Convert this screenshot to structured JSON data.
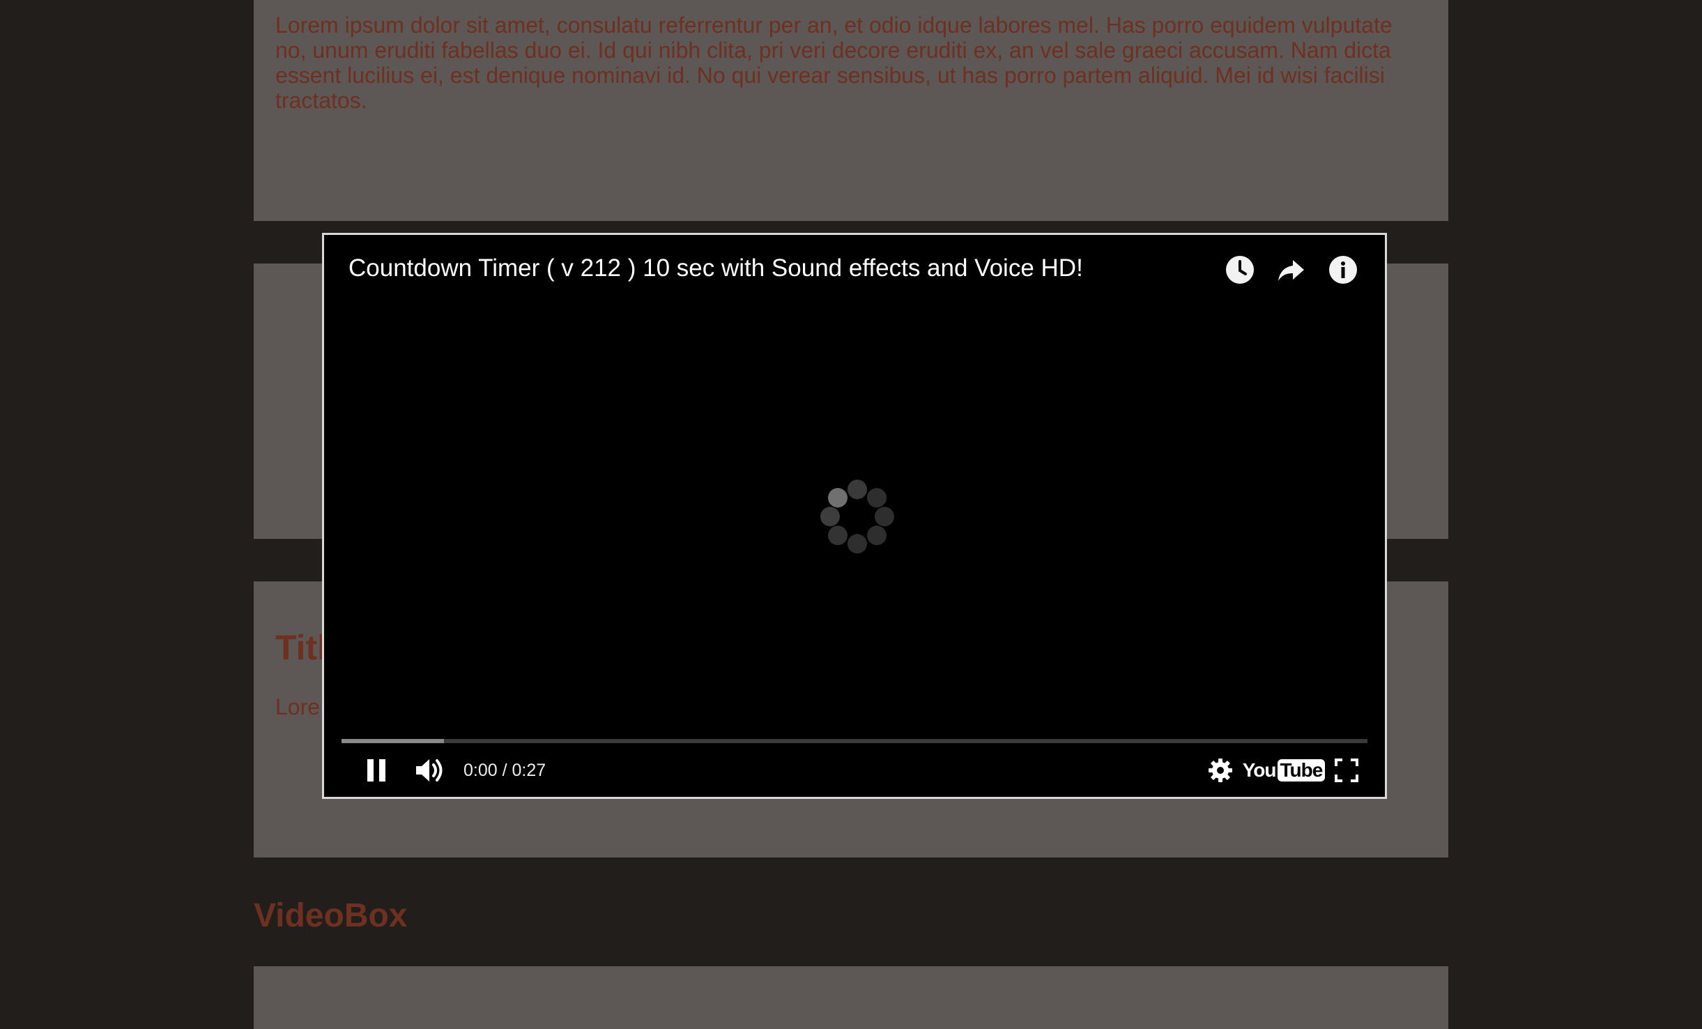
{
  "background_panels": {
    "top_paragraph": "Lorem ipsum dolor sit amet, consulatu referrentur per an, et odio idque labores mel. Has porro equidem vulputate no, unum eruditi fabellas duo ei. Id qui nibh clita, pri veri decore eruditi ex, an vel sale graeci accusam. Nam dicta essent lucilius ei, est denique nominavi id. No qui verear sensibus, ut has porro partem aliquid. Mei id wisi facilisi tractatos.",
    "low_title_visible": "Titl",
    "low_paragraph_fragment": "Lore",
    "section_heading": "VideoBox"
  },
  "video_player": {
    "title": "Countdown Timer ( v 212 ) 10 sec with Sound effects and Voice HD!",
    "current_time": "0:00",
    "duration": "0:27",
    "time_display": "0:00 / 0:27",
    "buffered_fraction": 0.1,
    "played_fraction": 0.0,
    "state": "loading",
    "top_icons": [
      "watch-later-icon",
      "share-icon",
      "info-icon"
    ],
    "control_icons": [
      "pause-icon",
      "volume-icon",
      "settings-icon",
      "youtube-logo",
      "fullscreen-icon"
    ],
    "logo": {
      "you": "You",
      "tube": "Tube"
    }
  },
  "colors": {
    "page_background": "#211e1c",
    "panel_background": "#5d5856",
    "text_accent": "#6e3020",
    "player_border": "#d9d9d9"
  }
}
